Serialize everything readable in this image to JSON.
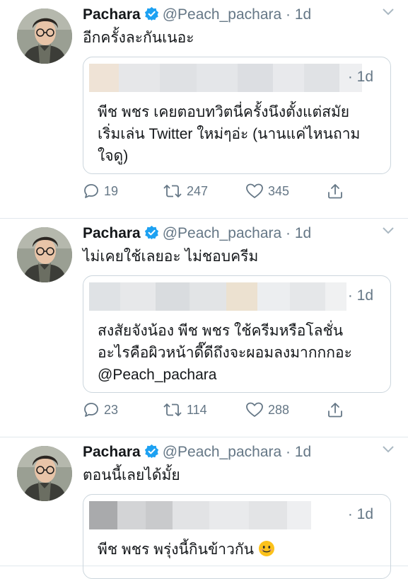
{
  "tweets": [
    {
      "name": "Pachara",
      "handle": "@Peach_pachara",
      "dot": "·",
      "time": "1d",
      "text": "อีกครั้งละกันเนอะ",
      "quote": {
        "time": "· 1d",
        "lines": [
          "พีช พชร เคยตอบทวิตนี่ครั้งนึงตั้งแต่สมัย",
          "เริ่มเล่น Twitter ใหม่ๆอ่ะ (นานแค่ไหนถาม",
          "ใจดู)"
        ]
      },
      "replies": "19",
      "retweets": "247",
      "likes": "345"
    },
    {
      "name": "Pachara",
      "handle": "@Peach_pachara",
      "dot": "·",
      "time": "1d",
      "text": "ไม่เคยใช้เลยอะ ไม่ชอบครีม",
      "quote": {
        "time": "· 1d",
        "lines": [
          "สงสัยจังน้อง พีช พชร ใช้ครีมหรือโลชั่น",
          "อะไรคือผิวหน้าดี๊ดีถึงจะผอมลงมากกกอะ",
          "@Peach_pachara"
        ]
      },
      "replies": "23",
      "retweets": "114",
      "likes": "288"
    },
    {
      "name": "Pachara",
      "handle": "@Peach_pachara",
      "dot": "·",
      "time": "1d",
      "text": "ตอนนี้เลยได้มั้ย",
      "quote": {
        "time": "· 1d",
        "lines": [
          "พีช พชร พรุ่งนี้กินข้าวกัน"
        ]
      }
    }
  ],
  "icons": {
    "verified": "verified-badge-icon",
    "caret": "chevron-down-icon",
    "reply": "reply-icon",
    "retweet": "retweet-icon",
    "like": "heart-icon",
    "share": "share-icon",
    "emoji": "smiling-face-emoji"
  },
  "colors": {
    "verified": "#1da1f2",
    "secondary": "#657786",
    "border": "#ccd6dd"
  }
}
